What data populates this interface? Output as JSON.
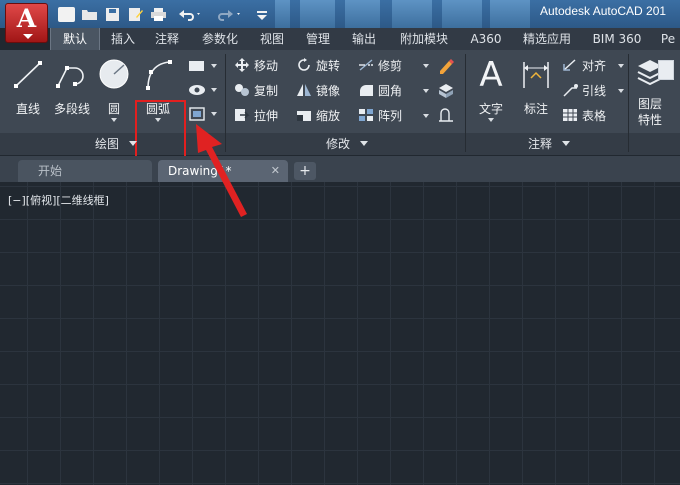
{
  "app": {
    "title": "Autodesk AutoCAD 201",
    "logo_letter": "A"
  },
  "quick_access": [
    "new-icon",
    "open-icon",
    "save-icon",
    "saveas-icon",
    "print-icon",
    "undo-icon",
    "redo-icon",
    "customize-icon"
  ],
  "ribbon_tabs": [
    {
      "label": "默认",
      "active": true
    },
    {
      "label": "插入"
    },
    {
      "label": "注释"
    },
    {
      "label": "参数化"
    },
    {
      "label": "视图"
    },
    {
      "label": "管理"
    },
    {
      "label": "输出"
    },
    {
      "label": "附加模块"
    },
    {
      "label": "A360"
    },
    {
      "label": "精选应用"
    },
    {
      "label": "BIM 360"
    },
    {
      "label": "Pe"
    }
  ],
  "draw_panel": {
    "label": "绘图",
    "line": "直线",
    "polyline": "多段线",
    "circle": "圆",
    "arc": "圆弧"
  },
  "modify_panel": {
    "label": "修改",
    "move": "移动",
    "rotate": "旋转",
    "trim": "修剪",
    "copy": "复制",
    "mirror": "镜像",
    "fillet": "圆角",
    "stretch": "拉伸",
    "scale": "缩放",
    "array": "阵列"
  },
  "annotation_panel": {
    "label": "注释",
    "text": "文字",
    "dimension": "标注",
    "align": "对齐",
    "leader": "引线",
    "table": "表格"
  },
  "layers_panel": {
    "layer_props_line1": "图层",
    "layer_props_line2": "特性"
  },
  "file_tabs": {
    "start": "开始",
    "drawing": "Drawing1*",
    "close_glyph": "✕",
    "add_glyph": "+"
  },
  "viewport": {
    "label": "[−][俯视][二维线框]"
  },
  "colors": {
    "highlight": "#e21f1f",
    "arrow": "#e02222",
    "canvas_bg": "#212830",
    "ribbon_bg": "#3f4853"
  }
}
